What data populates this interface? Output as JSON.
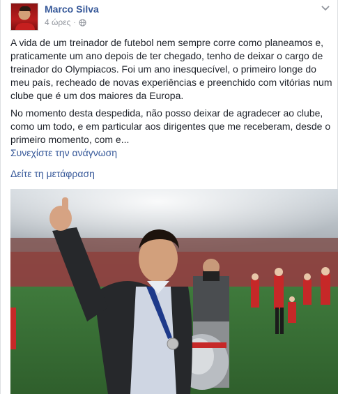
{
  "post": {
    "author": "Marco Silva",
    "time": "4 ώρες",
    "privacy_icon": "globe-icon",
    "options_icon": "chevron-down-icon",
    "paragraph_1": "A vida de um treinador de futebol nem sempre corre como planeamos e, praticamente um ano depois de ter chegado, tenho de deixar o cargo de treinador do Olympiacos. Foi um ano inesquecível, o primeiro longe do meu país, recheado de novas experiências e preenchido com vitórias num clube que é um dos maiores da Europa.",
    "paragraph_2": "No momento desta despedida, não posso deixar de agradecer ao clube, como um todo, e em particular aos dirigentes que me receberam, desde o primeiro momento, com e...",
    "see_more": "Συνεχίστε την ανάγνωση",
    "translate": "Δείτε τη μετάφραση",
    "colors": {
      "link": "#365899",
      "text": "#1d2129",
      "meta": "#90949c"
    }
  }
}
